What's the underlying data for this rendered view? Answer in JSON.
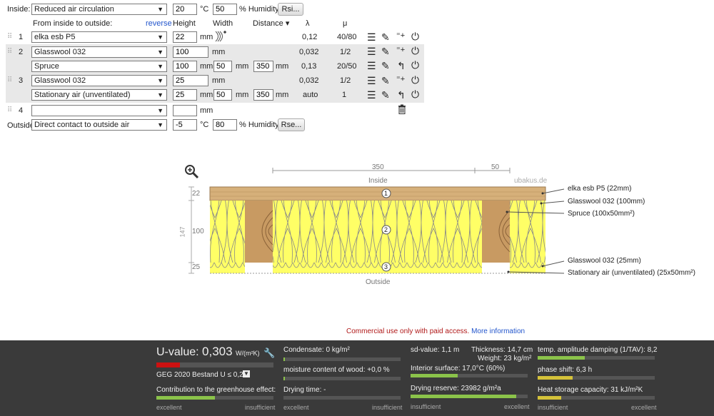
{
  "inside": {
    "label": "Inside:",
    "condition": "Reduced air circulation",
    "temp": "20",
    "temp_unit": "°C",
    "humidity": "50",
    "humidity_unit": "% Humidity",
    "rsi_button": "Rsi..."
  },
  "header": {
    "from_label": "From inside to outside:",
    "reverse": "reverse",
    "height": "Height",
    "width": "Width",
    "distance": "Distance",
    "lambda": "λ",
    "mu": "μ"
  },
  "layers": [
    {
      "num": "1",
      "material": "elka esb P5",
      "height": "22",
      "unit": "mm",
      "lambda": "0,12",
      "mu": "40/80"
    },
    {
      "num": "2",
      "material": "Glasswool 032",
      "height": "100",
      "unit": "mm",
      "lambda": "0,032",
      "mu": "1/2",
      "sub": {
        "material": "Spruce",
        "height": "100",
        "width": "50",
        "distance": "350",
        "unit": "mm",
        "lambda": "0,13",
        "mu": "20/50"
      }
    },
    {
      "num": "3",
      "material": "Glasswool 032",
      "height": "25",
      "unit": "mm",
      "lambda": "0,032",
      "mu": "1/2",
      "sub": {
        "material": "Stationary air (unventilated)",
        "height": "25",
        "width": "50",
        "distance": "350",
        "unit": "mm",
        "lambda": "auto",
        "mu": "1"
      }
    },
    {
      "num": "4",
      "material": "",
      "height": "",
      "unit": "mm"
    }
  ],
  "outside": {
    "label": "Outside",
    "condition": "Direct contact to outside air",
    "temp": "-5",
    "temp_unit": "°C",
    "humidity": "80",
    "humidity_unit": "% Humidity",
    "rse_button": "Rse..."
  },
  "diagram": {
    "dim_350": "350",
    "dim_50": "50",
    "inside": "Inside",
    "outside": "Outside",
    "watermark": "ubakus.de",
    "left_dims": {
      "d22": "22",
      "d100": "100",
      "d25": "25",
      "d147": "147"
    },
    "markers": [
      "1",
      "2",
      "3"
    ],
    "labels": [
      "elka esb P5 (22mm)",
      "Glasswool 032 (100mm)",
      "Spruce (100x50mm²)",
      "Glasswool 032 (25mm)",
      "Stationary air (unventilated) (25x50mm²)"
    ]
  },
  "notice": {
    "text": "Commercial use only with paid access.",
    "link": "More information"
  },
  "results": {
    "uvalue_label": "U-value:",
    "uvalue": "0,303",
    "uvalue_unit": "W/(m²K)",
    "geg": "GEG 2020 Bestand U ≤ 0,24",
    "greenhouse": "Contribution to the greenhouse effect:",
    "condensate": "Condensate: 0 kg/m²",
    "moisture": "moisture content of wood: +0,0 %",
    "drying_time": "Drying time: -",
    "sd": "sd-value: 1,1 m",
    "thickness": "Thickness: 14,7 cm",
    "weight": "Weight: 23 kg/m²",
    "interior": "Interior surface: 17,0°C (60%)",
    "drying_reserve": "Drying reserve: 23982 g/m²a",
    "tav": "temp. amplitude damping (1/TAV): 8,2",
    "phase": "phase shift: 6,3 h",
    "heat": "Heat storage capacity: 31 kJ/m²K",
    "excellent": "excellent",
    "insufficient": "insufficient",
    "bars": {
      "u": 0.2,
      "greenhouse": 0.5,
      "condensate": 0.01,
      "moisture": 0.01,
      "interior": 0.4,
      "drying_reserve": 0.9,
      "tav": 0.4,
      "phase": 0.3,
      "heat": 0.2
    },
    "colors": {
      "good": "#8bc34a",
      "bad": "#cc1111",
      "mid": "#d4c23a"
    }
  }
}
